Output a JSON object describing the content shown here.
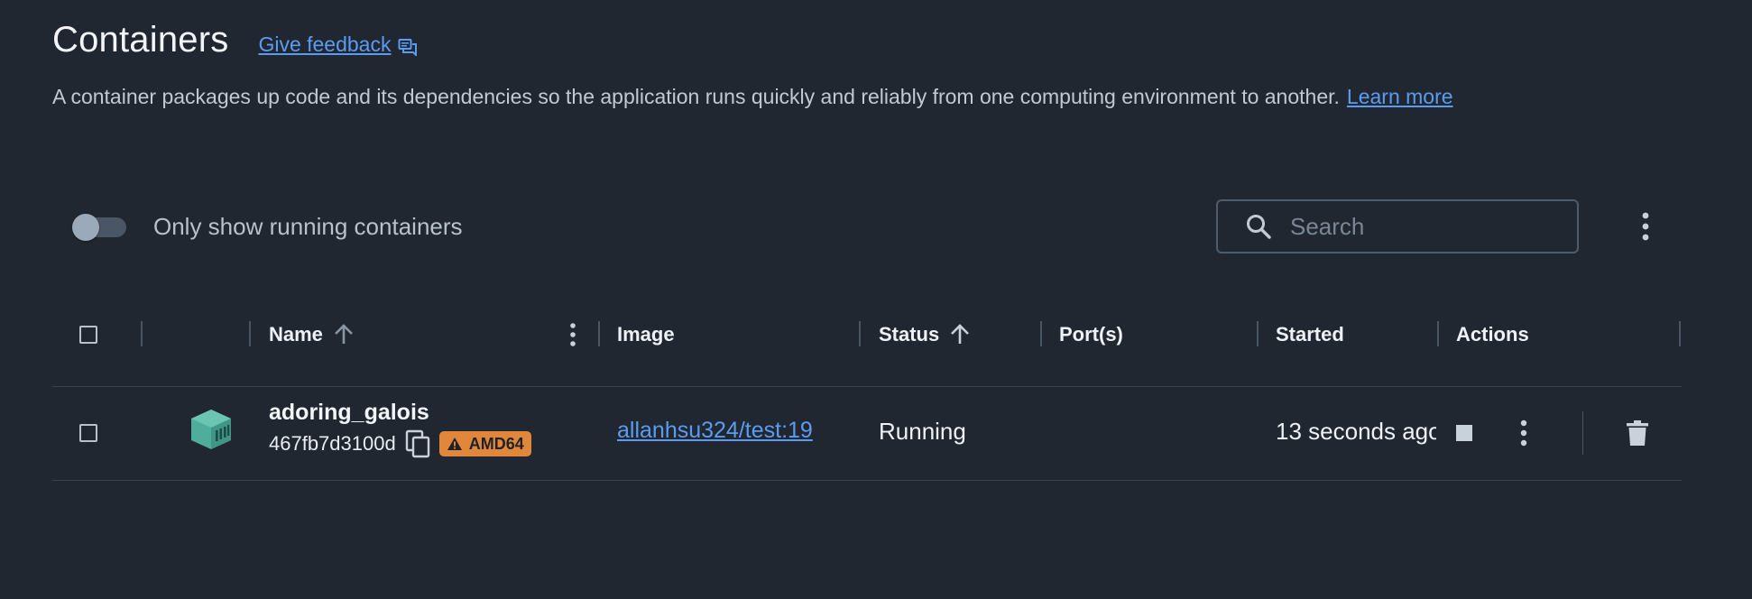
{
  "header": {
    "title": "Containers",
    "feedback_label": "Give feedback",
    "description": "A container packages up code and its dependencies so the application runs quickly and reliably from one computing environment to another.",
    "learn_more_label": "Learn more"
  },
  "toolbar": {
    "toggle_label": "Only show running containers",
    "toggle_on": false,
    "search_placeholder": "Search"
  },
  "table": {
    "columns": [
      "Name",
      "Image",
      "Status",
      "Port(s)",
      "Started",
      "Actions"
    ],
    "rows": [
      {
        "name": "adoring_galois",
        "id": "467fb7d3100d",
        "badge": "AMD64",
        "image": "allanhsu324/test:19",
        "status": "Running",
        "ports": "",
        "started": "13 seconds ago"
      }
    ]
  },
  "colors": {
    "background": "#202730",
    "link": "#5c9cf0",
    "container_icon": "#4fae9b",
    "badge": "#e0873b"
  },
  "icons": [
    "feedback-icon",
    "search-icon",
    "kebab-menu-icon",
    "sort-up-icon",
    "container-icon",
    "copy-icon",
    "warning-icon",
    "stop-icon",
    "trash-icon"
  ]
}
